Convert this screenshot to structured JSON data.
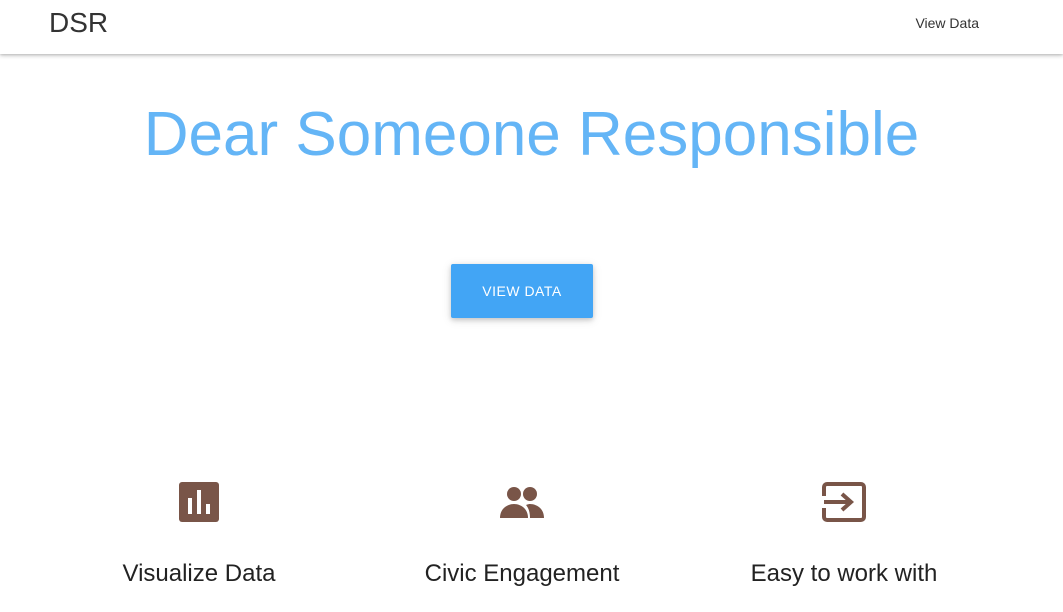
{
  "navbar": {
    "brand": "DSR",
    "link_label": "View Data"
  },
  "hero": {
    "title": "Dear Someone Responsible",
    "button_label": "VIEW DATA"
  },
  "features": [
    {
      "icon": "bar-chart-icon",
      "title": "Visualize Data"
    },
    {
      "icon": "people-icon",
      "title": "Civic Engagement"
    },
    {
      "icon": "input-icon",
      "title": "Easy to work with"
    }
  ],
  "colors": {
    "title": "#64b5f6",
    "button": "#42a5f5",
    "icon": "#795548"
  }
}
